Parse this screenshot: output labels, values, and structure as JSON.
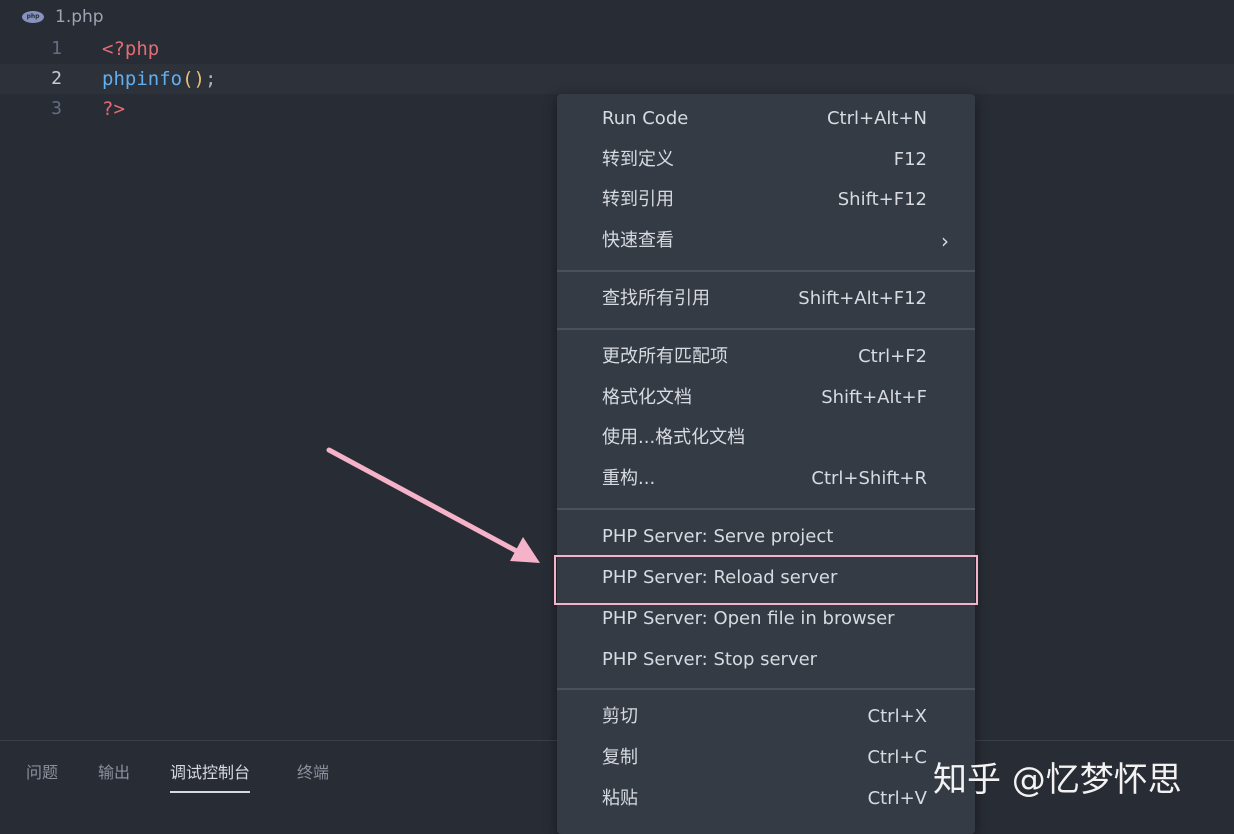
{
  "breadcrumb": {
    "file_icon": "php-file-icon",
    "file_name": "1.php"
  },
  "editor": {
    "lines": [
      {
        "number": "1",
        "code": "<?php"
      },
      {
        "number": "2",
        "fn": "phpinfo",
        "paren": "()",
        "end": ";"
      },
      {
        "number": "3",
        "code": "?>"
      }
    ],
    "current_line": 2
  },
  "context_menu": {
    "groups": [
      [
        {
          "label": "Run Code",
          "shortcut": "Ctrl+Alt+N"
        },
        {
          "label": "转到定义",
          "shortcut": "F12"
        },
        {
          "label": "转到引用",
          "shortcut": "Shift+F12"
        },
        {
          "label": "快速查看",
          "submenu_icon": "chevron-right-icon"
        }
      ],
      [
        {
          "label": "查找所有引用",
          "shortcut": "Shift+Alt+F12"
        }
      ],
      [
        {
          "label": "更改所有匹配项",
          "shortcut": "Ctrl+F2"
        },
        {
          "label": "格式化文档",
          "shortcut": "Shift+Alt+F"
        },
        {
          "label": "使用...格式化文档"
        },
        {
          "label": "重构...",
          "shortcut": "Ctrl+Shift+R"
        }
      ],
      [
        {
          "label": "PHP Server: Serve project"
        },
        {
          "label": "PHP Server: Reload server"
        },
        {
          "label": "PHP Server: Open file in browser"
        },
        {
          "label": "PHP Server: Stop server"
        }
      ],
      [
        {
          "label": "剪切",
          "shortcut": "Ctrl+X"
        },
        {
          "label": "复制",
          "shortcut": "Ctrl+C"
        },
        {
          "label": "粘贴",
          "shortcut": "Ctrl+V"
        }
      ]
    ],
    "highlighted_item": "PHP Server: Reload server"
  },
  "panel": {
    "tabs": [
      "问题",
      "输出",
      "调试控制台",
      "终端"
    ],
    "active_tab": "调试控制台"
  },
  "watermark": {
    "text": "知乎 @忆梦怀思"
  },
  "colors": {
    "background": "#282c34",
    "menu_background": "#353b45",
    "annotation": "#f5b2c8",
    "tag": "#e06c75",
    "function": "#61afef",
    "paren": "#e5c07b"
  }
}
